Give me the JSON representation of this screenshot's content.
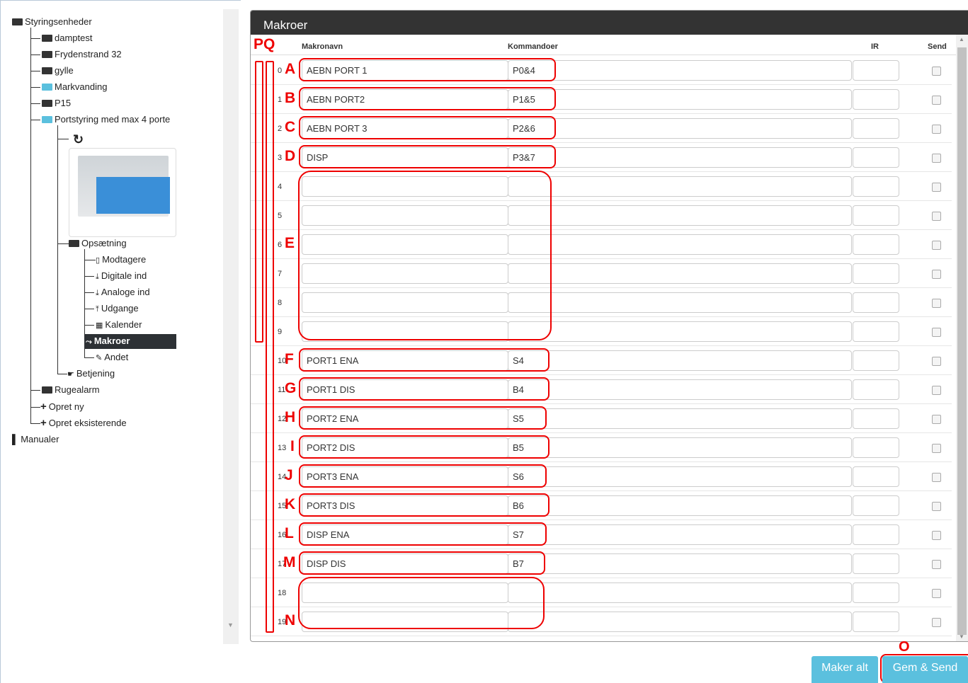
{
  "tree": {
    "root": "Styringsenheder",
    "items": [
      {
        "label": "damptest"
      },
      {
        "label": "Frydenstrand 32"
      },
      {
        "label": "gylle"
      },
      {
        "label": "Markvanding"
      },
      {
        "label": "P15"
      },
      {
        "label": "Portstyring med max 4 porte"
      }
    ],
    "setup": "Opsætning",
    "sub": [
      {
        "label": "Modtagere",
        "icon": "phone-icon"
      },
      {
        "label": "Digitale ind",
        "icon": "input-icon"
      },
      {
        "label": "Analoge ind",
        "icon": "input-icon"
      },
      {
        "label": "Udgange",
        "icon": "output-icon"
      },
      {
        "label": "Kalender",
        "icon": "calendar-icon"
      },
      {
        "label": "Makroer",
        "icon": "shuffle-icon"
      },
      {
        "label": "Andet",
        "icon": "edit-icon"
      }
    ],
    "betjening": "Betjening",
    "rugealarm": "Rugealarm",
    "opret_ny": "Opret ny",
    "opret_eks": "Opret eksisterende",
    "manualer": "Manualer"
  },
  "panel": {
    "title": "Makroer",
    "col_name": "Makronavn",
    "col_cmd": "Kommandoer",
    "col_ir": "IR",
    "col_send": "Send"
  },
  "rows": [
    {
      "n": "0",
      "name": "AEBN PORT 1",
      "cmd": "P0&4"
    },
    {
      "n": "1",
      "name": "AEBN PORT2",
      "cmd": "P1&5"
    },
    {
      "n": "2",
      "name": "AEBN PORT 3",
      "cmd": "P2&6"
    },
    {
      "n": "3",
      "name": "DISP",
      "cmd": "P3&7"
    },
    {
      "n": "4",
      "name": "",
      "cmd": ""
    },
    {
      "n": "5",
      "name": "",
      "cmd": ""
    },
    {
      "n": "6",
      "name": "",
      "cmd": ""
    },
    {
      "n": "7",
      "name": "",
      "cmd": ""
    },
    {
      "n": "8",
      "name": "",
      "cmd": ""
    },
    {
      "n": "9",
      "name": "",
      "cmd": ""
    },
    {
      "n": "10",
      "name": "PORT1 ENA",
      "cmd": "S4"
    },
    {
      "n": "11",
      "name": "PORT1 DIS",
      "cmd": "B4"
    },
    {
      "n": "12",
      "name": "PORT2 ENA",
      "cmd": "S5"
    },
    {
      "n": "13",
      "name": "PORT2 DIS",
      "cmd": "B5"
    },
    {
      "n": "14",
      "name": "PORT3 ENA",
      "cmd": "S6"
    },
    {
      "n": "15",
      "name": "PORT3 DIS",
      "cmd": "B6"
    },
    {
      "n": "16",
      "name": "DISP ENA",
      "cmd": "S7"
    },
    {
      "n": "17",
      "name": "DISP DIS",
      "cmd": "B7"
    },
    {
      "n": "18",
      "name": "",
      "cmd": ""
    },
    {
      "n": "19",
      "name": "",
      "cmd": ""
    }
  ],
  "annotations": {
    "pq": "PQ",
    "letters": [
      "A",
      "B",
      "C",
      "D",
      "E",
      "F",
      "G",
      "H",
      "I",
      "J",
      "K",
      "L",
      "M",
      "N"
    ],
    "o": "O"
  },
  "buttons": {
    "maker_alt": "Maker alt",
    "gem_send": "Gem & Send"
  },
  "colors": {
    "accent": "#5bc0de",
    "header": "#333333",
    "annotation": "#ee0000"
  }
}
